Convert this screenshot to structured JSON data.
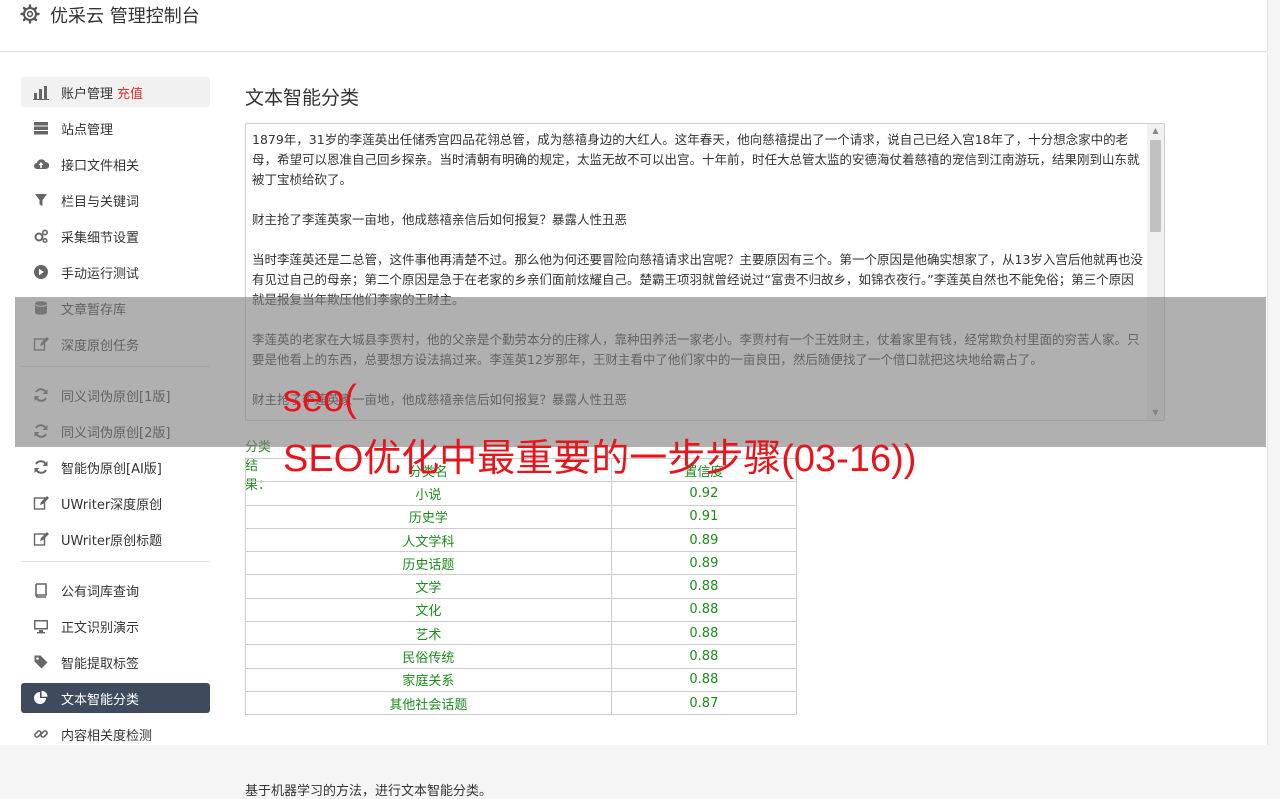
{
  "app": {
    "title": "优采云 管理控制台"
  },
  "sidebar": {
    "groups": [
      [
        {
          "label": "账户管理",
          "extra": "充值",
          "icon": "bar-chart-icon",
          "state": "hl"
        },
        {
          "label": "站点管理",
          "icon": "server-icon"
        },
        {
          "label": "接口文件相关",
          "icon": "cloud-upload-icon"
        },
        {
          "label": "栏目与关键词",
          "icon": "filter-icon"
        },
        {
          "label": "采集细节设置",
          "icon": "gears-icon"
        },
        {
          "label": "手动运行测试",
          "icon": "play-icon"
        },
        {
          "label": "文章暂存库",
          "icon": "database-icon"
        },
        {
          "label": "深度原创任务",
          "icon": "edit-icon"
        }
      ],
      [
        {
          "label": "同义词伪原创[1版]",
          "icon": "refresh-icon"
        },
        {
          "label": "同义词伪原创[2版]",
          "icon": "refresh-icon"
        },
        {
          "label": "智能伪原创[AI版]",
          "icon": "refresh-icon"
        },
        {
          "label": "UWriter深度原创",
          "icon": "edit-icon"
        },
        {
          "label": "UWriter原创标题",
          "icon": "edit-icon"
        }
      ],
      [
        {
          "label": "公有词库查询",
          "icon": "book-icon"
        },
        {
          "label": "正文识别演示",
          "icon": "monitor-icon"
        },
        {
          "label": "智能提取标签",
          "icon": "tag-icon"
        },
        {
          "label": "文本智能分类",
          "icon": "pie-chart-icon",
          "state": "active"
        },
        {
          "label": "内容相关度检测",
          "icon": "link-icon"
        }
      ]
    ]
  },
  "main": {
    "title": "文本智能分类",
    "text_paragraphs": [
      "1879年，31岁的李莲英出任储秀宫四品花翎总管，成为慈禧身边的大红人。这年春天，他向慈禧提出了一个请求，说自己已经入宫18年了，十分想念家中的老母，希望可以恩准自己回乡探亲。当时清朝有明确的规定，太监无故不可以出宫。十年前，时任大总管太监的安德海仗着慈禧的宠信到江南游玩，结果刚到山东就被丁宝桢给砍了。",
      "财主抢了李莲英家一亩地，他成慈禧亲信后如何报复？暴露人性丑恶",
      "当时李莲英还是二总管，这件事他再清楚不过。那么他为何还要冒险向慈禧请求出宫呢？主要原因有三个。第一个原因是他确实想家了，从13岁入宫后他就再也没有见过自己的母亲；第二个原因是急于在老家的乡亲们面前炫耀自己。楚霸王项羽就曾经说过“富贵不归故乡，如锦衣夜行。”李莲英自然也不能免俗；第三个原因就是报复当年欺压他们李家的王财主。",
      "李莲英的老家在大城县李贾村，他的父亲是个勤劳本分的庄稼人，靠种田养活一家老小。李贾村有一个王姓财主，仗着家里有钱，经常欺负村里面的穷苦人家。只要是他看上的东西，总要想方设法搞过来。李莲英12岁那年，王财主看中了他们家中的一亩良田，然后随便找了一个借口就把这块地给霸占了。",
      "财主抢了李莲英家一亩地，他成慈禧亲信后如何报复？暴露人性丑恶"
    ],
    "result_label": "分类结果：",
    "table": {
      "headers": [
        "分类名",
        "置信度"
      ],
      "rows": [
        [
          "小说",
          "0.92"
        ],
        [
          "历史学",
          "0.91"
        ],
        [
          "人文学科",
          "0.89"
        ],
        [
          "历史话题",
          "0.89"
        ],
        [
          "文学",
          "0.88"
        ],
        [
          "文化",
          "0.88"
        ],
        [
          "艺术",
          "0.88"
        ],
        [
          "民俗传统",
          "0.88"
        ],
        [
          "家庭关系",
          "0.88"
        ],
        [
          "其他社会话题",
          "0.87"
        ]
      ]
    },
    "footnote": "基于机器学习的方法，进行文本智能分类。"
  },
  "watermark": {
    "line1": "seo(",
    "line2": "SEO优化中最重要的一步步骤(03-16))"
  },
  "colors": {
    "active_bg": "#3d4b5d",
    "green": "#1a8c1a",
    "red": "#e8141c"
  }
}
